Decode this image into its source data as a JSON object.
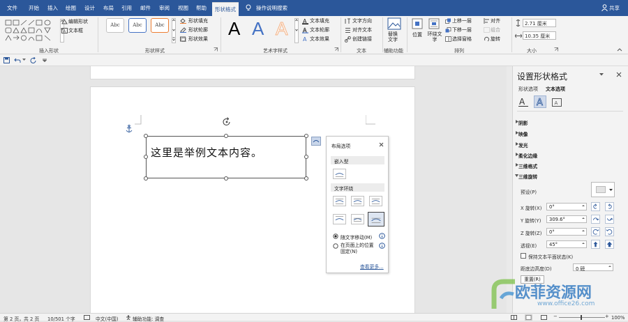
{
  "tabs": {
    "file": "文件",
    "home": "开始",
    "insert": "插入",
    "draw": "绘图",
    "design": "设计",
    "layout": "布局",
    "references": "引用",
    "mailings": "邮件",
    "review": "审阅",
    "view": "视图",
    "help": "帮助",
    "shape_format": "形状格式",
    "tellme": "操作说明搜索",
    "share": "共享"
  },
  "ribbon": {
    "insert_shapes": {
      "label": "插入形状",
      "edit_shape": "编辑形状",
      "text_box": "文本框"
    },
    "shape_styles": {
      "label": "形状样式",
      "thumb": "Abc",
      "fill": "形状填充",
      "outline": "形状轮廓",
      "effects": "形状效果"
    },
    "wordart": {
      "label": "艺术字样式",
      "letter": "A",
      "text_fill": "文本填充",
      "text_outline": "文本轮廓",
      "text_effects": "文本效果"
    },
    "text": {
      "label": "文本",
      "direction": "文字方向",
      "align": "对齐文本",
      "link": "创建链接"
    },
    "accessibility": {
      "label": "辅助功能",
      "alt_text": "替换文字"
    },
    "arrange": {
      "label": "排列",
      "position": "位置",
      "wrap": "环绕文字",
      "forward": "上移一层",
      "backward": "下移一层",
      "pane": "选择窗格",
      "align": "对齐",
      "group": "组合",
      "rotate": "旋转"
    },
    "size": {
      "label": "大小",
      "height": "2.71 厘米",
      "width": "10.35 厘米"
    }
  },
  "document": {
    "text": "这里是举例文本内容。"
  },
  "layout_popup": {
    "title": "布局选项",
    "inline": "嵌入型",
    "wrap": "文字环绕",
    "move_with_text": "随文字移动(M)",
    "fix_position": "在页面上的位置固定(N)",
    "more": "查看更多..."
  },
  "pane": {
    "title": "设置形状格式",
    "tab_shape": "形状选项",
    "tab_text": "文本选项",
    "sections": [
      "阴影",
      "映像",
      "发光",
      "柔化边缘",
      "三维格式",
      "三维旋转"
    ],
    "preset": "预设(P)",
    "x_label": "X 旋转(X)",
    "x_value": "0°",
    "y_label": "Y 旋转(Y)",
    "y_value": "309.6°",
    "z_label": "Z 旋转(Z)",
    "z_value": "0°",
    "persp_label": "透视(E)",
    "persp_value": "45°",
    "keep_flat": "保持文本平面状态(K)",
    "ground_label": "距底边高度(D)",
    "ground_value": "0 磅",
    "reset": "重置(R)"
  },
  "status": {
    "page": "第 2 页，共 2 页",
    "words": "10/501 个字",
    "lang": "中文(中国)",
    "access": "辅助功能: 调查",
    "zoom": "100%"
  },
  "watermark": {
    "name": "欧菲资源网",
    "url": "www.office26.com"
  },
  "colors": {
    "accent": "#2b579a",
    "ribbon": "#f3f3f3",
    "wordart_blue": "#4472c4",
    "wordart_orange": "#f4b183"
  }
}
